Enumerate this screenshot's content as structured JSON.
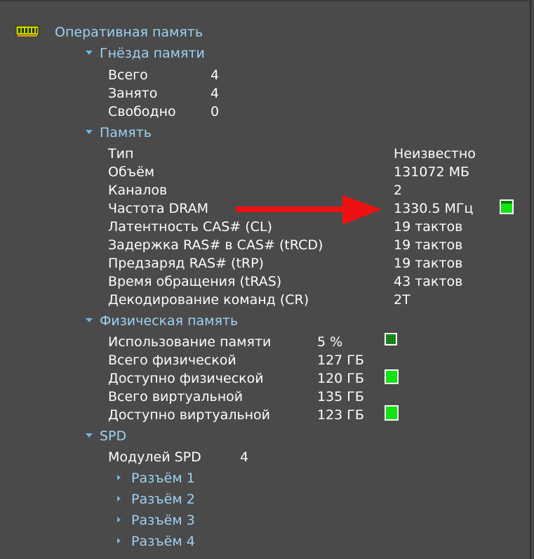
{
  "root": {
    "icon": "ram-module-icon",
    "label": "Оперативная память"
  },
  "slots": {
    "title": "Гнёзда памяти",
    "rows": [
      {
        "label": "Всего",
        "value": "4"
      },
      {
        "label": "Занято",
        "value": "4"
      },
      {
        "label": "Свободно",
        "value": "0"
      }
    ]
  },
  "memory": {
    "title": "Память",
    "rows": [
      {
        "label": "Тип",
        "value": "Неизвестно"
      },
      {
        "label": "Объём",
        "value": "131072 МБ"
      },
      {
        "label": "Каналов",
        "value": "2"
      },
      {
        "label": "Частота DRAM",
        "value": "1330.5 МГц"
      },
      {
        "label": "Латентность CAS# (CL)",
        "value": "19 тактов"
      },
      {
        "label": "Задержка RAS# в CAS# (tRCD)",
        "value": "19 тактов"
      },
      {
        "label": "Предзаряд RAS# (tRP)",
        "value": "19 тактов"
      },
      {
        "label": "Время обращения (tRAS)",
        "value": "43 тактов"
      },
      {
        "label": "Декодирование команд (CR)",
        "value": "2T"
      }
    ]
  },
  "physical": {
    "title": "Физическая память",
    "rows": [
      {
        "label": "Использование памяти",
        "value": "5 %"
      },
      {
        "label": "Всего физической",
        "value": "127 ГБ"
      },
      {
        "label": "Доступно физической",
        "value": "120 ГБ"
      },
      {
        "label": "Всего виртуальной",
        "value": "135 ГБ"
      },
      {
        "label": "Доступно виртуальной",
        "value": "123 ГБ"
      }
    ]
  },
  "spd": {
    "title": "SPD",
    "modules_label": "Модулей SPD",
    "modules_value": "4",
    "slots": [
      "Разъём 1",
      "Разъём 2",
      "Разъём 3",
      "Разъём 4"
    ]
  },
  "colors": {
    "background": "#4a4a4a",
    "link": "#9fd1f2",
    "indicator_green": "#12e312",
    "arrow_red": "#ee1111"
  }
}
